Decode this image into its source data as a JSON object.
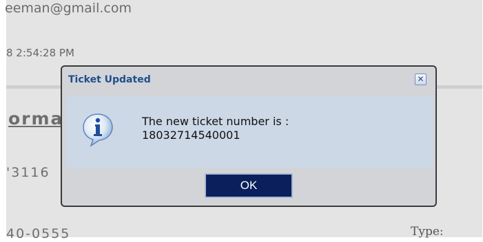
{
  "background": {
    "email": "eeman@gmail.com",
    "timestamp": "8 2:54:28 PM",
    "section_title": "orma",
    "phone_1": "'3116",
    "phone_2": "40-0555",
    "type_label": "Type:"
  },
  "dialog": {
    "title": "Ticket Updated",
    "close_icon": "close-icon",
    "info_icon": "info-icon",
    "message_line1": "The new ticket number is :",
    "message_line2": "18032714540001",
    "ok_label": "OK"
  },
  "colors": {
    "title_text": "#1f4f8c",
    "ok_button_bg": "#0a1f5c",
    "content_bg": "#ccd8e6",
    "dialog_bg": "#d2d4d8"
  }
}
